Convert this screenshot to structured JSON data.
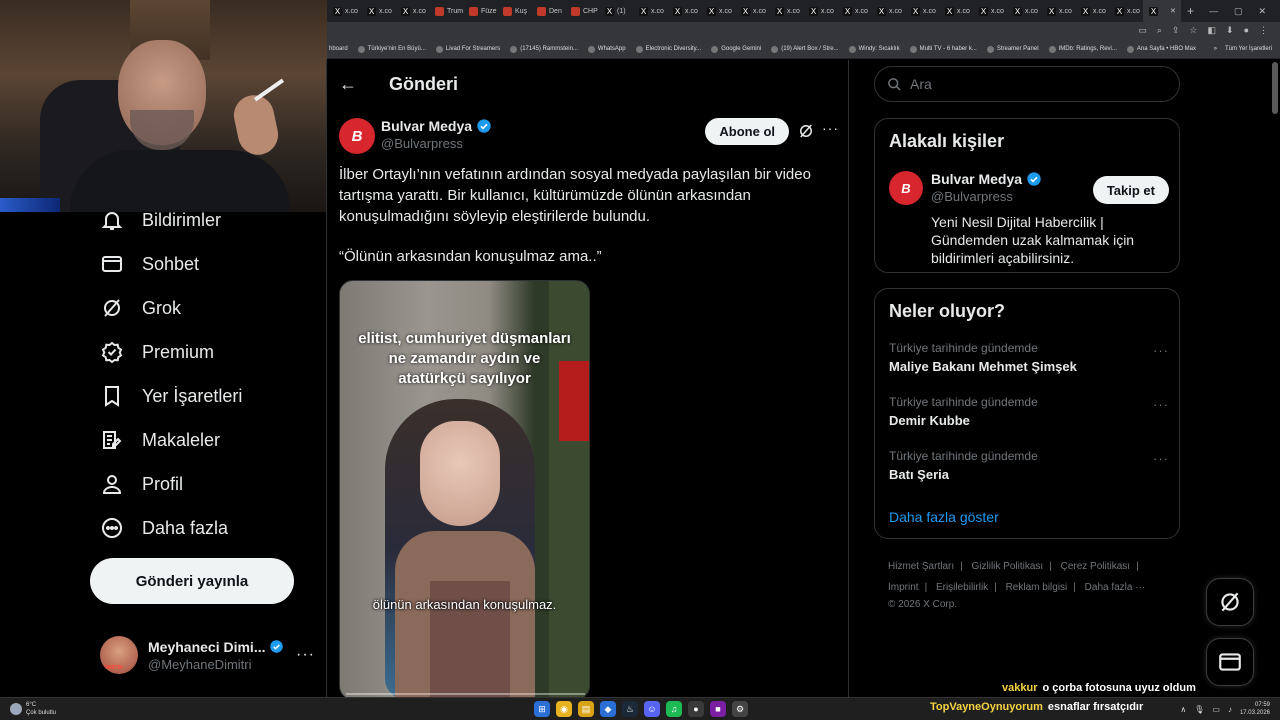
{
  "browser": {
    "tabs": [
      {
        "label": "x.co",
        "color": "#111111",
        "glyph": "X"
      },
      {
        "label": "x.co",
        "color": "#111111",
        "glyph": "X"
      },
      {
        "label": "x.co",
        "color": "#111111",
        "glyph": "X"
      },
      {
        "label": "Trum",
        "color": "#c0392b",
        "glyph": ""
      },
      {
        "label": "Füze",
        "color": "#c0392b",
        "glyph": ""
      },
      {
        "label": "Kuş",
        "color": "#c0392b",
        "glyph": ""
      },
      {
        "label": "Den",
        "color": "#c0392b",
        "glyph": ""
      },
      {
        "label": "CHP",
        "color": "#c0392b",
        "glyph": ""
      },
      {
        "label": "(1)",
        "color": "#111111",
        "glyph": "X"
      },
      {
        "label": "x.co",
        "color": "#111111",
        "glyph": "X"
      },
      {
        "label": "x.co",
        "color": "#111111",
        "glyph": "X"
      },
      {
        "label": "x.co",
        "color": "#111111",
        "glyph": "X"
      },
      {
        "label": "x.co",
        "color": "#111111",
        "glyph": "X"
      },
      {
        "label": "x.co",
        "color": "#111111",
        "glyph": "X"
      },
      {
        "label": "x.co",
        "color": "#111111",
        "glyph": "X"
      },
      {
        "label": "x.co",
        "color": "#111111",
        "glyph": "X"
      },
      {
        "label": "x.co",
        "color": "#111111",
        "glyph": "X"
      },
      {
        "label": "x.co",
        "color": "#111111",
        "glyph": "X"
      },
      {
        "label": "x.co",
        "color": "#111111",
        "glyph": "X"
      },
      {
        "label": "x.co",
        "color": "#111111",
        "glyph": "X"
      },
      {
        "label": "x.co",
        "color": "#111111",
        "glyph": "X"
      },
      {
        "label": "x.co",
        "color": "#111111",
        "glyph": "X"
      },
      {
        "label": "x.co",
        "color": "#111111",
        "glyph": "X"
      },
      {
        "label": "x.co",
        "color": "#111111",
        "glyph": "X"
      },
      {
        "label": "",
        "color": "#111111",
        "glyph": "X",
        "active": true
      }
    ],
    "bookmarks": [
      "hboard",
      "Türkiye'nin En Büyü...",
      "Livad For Streamers",
      "(17145) Rammstein...",
      "WhatsApp",
      "Electronic Diversity...",
      "Google Gemini",
      "(19) Alert Box / Stre...",
      "Windy: Sıcaklık",
      "Multi TV - 6 haber k...",
      "Streamer Panel",
      "IMDb: Ratings, Revi...",
      "Ana Sayfa • HBO Max"
    ],
    "bookmarks_more": "»",
    "bookmarks_all": "Tüm Yer İşaretleri"
  },
  "nav": {
    "items": [
      {
        "label": "Bildirimler",
        "icon": "bell-icon"
      },
      {
        "label": "Sohbet",
        "icon": "mail-icon"
      },
      {
        "label": "Grok",
        "icon": "grok-icon"
      },
      {
        "label": "Premium",
        "icon": "premium-icon"
      },
      {
        "label": "Yer İşaretleri",
        "icon": "bookmark-icon"
      },
      {
        "label": "Makaleler",
        "icon": "article-icon"
      },
      {
        "label": "Profil",
        "icon": "profile-icon"
      },
      {
        "label": "Daha fazla",
        "icon": "more-circle-icon"
      }
    ],
    "post_button": "Gönderi yayınla",
    "account": {
      "name": "Meyhaneci Dimi...",
      "handle": "@MeyhaneDimitri",
      "avatar_tag": "DIMITRI"
    }
  },
  "post": {
    "header_title": "Gönderi",
    "author": {
      "name": "Bulvar Medya",
      "handle": "@Bulvarpress",
      "avatar_text": "B"
    },
    "follow_label": "Abone ol",
    "text": "İlber Ortaylı’nın vefatının ardından sosyal medyada paylaşılan bir video tartışma yarattı. Bir kullanıcı, kültürümüzde ölünün arkasından konuşulmadığını söyleyip eleştirilerde bulundu.",
    "quote": "“Ölünün arkasından konuşulmaz ama..”",
    "video": {
      "caption_top": "elitist, cumhuriyet düşmanları ne zamandır aydın ve atatürkçü sayılıyor",
      "caption_bottom": "ölünün arkasından konuşulmaz."
    }
  },
  "sidebar": {
    "search_placeholder": "Ara",
    "related": {
      "title": "Alakalı kişiler",
      "name": "Bulvar Medya",
      "handle": "@Bulvarpress",
      "follow_label": "Takip et",
      "bio": "Yeni Nesil Dijital Habercilik | Gündemden uzak kalmamak için bildirimleri açabilirsiniz."
    },
    "trends": {
      "title": "Neler oluyor?",
      "items": [
        {
          "category": "Türkiye tarihinde gündemde",
          "name": "Maliye Bakanı Mehmet Şimşek"
        },
        {
          "category": "Türkiye tarihinde gündemde",
          "name": "Demir Kubbe"
        },
        {
          "category": "Türkiye tarihinde gündemde",
          "name": "Batı Şeria"
        }
      ],
      "show_more": "Daha fazla göster"
    },
    "footer": {
      "line1": [
        "Hizmet Şartları",
        "Gizlilik Politikası",
        "Çerez Politikası"
      ],
      "line2": [
        "Imprint",
        "Erişilebilirlik",
        "Reklam bilgisi",
        "Daha fazla ···"
      ],
      "copyright": "© 2026 X Corp."
    }
  },
  "chat": [
    {
      "user": "vakkur",
      "message": "o çorba fotosuna uyuz oldum"
    },
    {
      "user": "TopVayneOynuyorum",
      "message": "esnaflar fırsatçıdır"
    }
  ],
  "taskbar": {
    "weather_temp": "6°C",
    "weather_desc": "Çok bulutlu",
    "time": "07:59",
    "date": "17.03.2026"
  },
  "colors": {
    "accent": "#1d9bf0",
    "brand_red": "#d7262d",
    "verified": "#1d9bf0"
  }
}
